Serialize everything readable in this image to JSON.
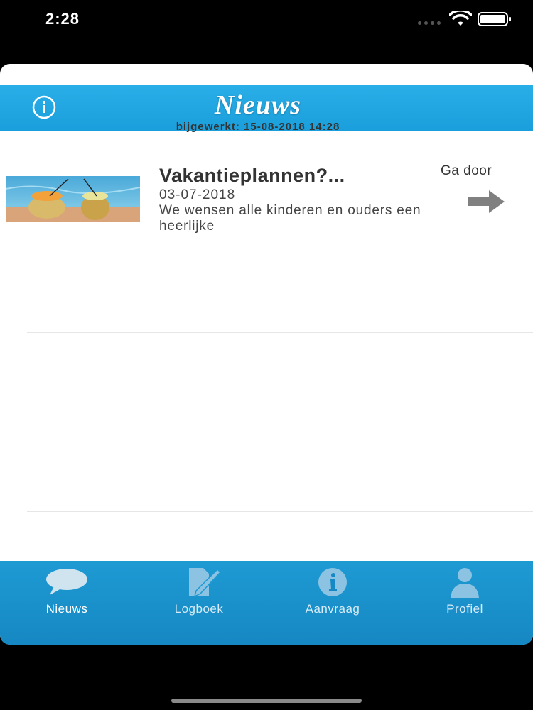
{
  "status_bar": {
    "time": "2:28"
  },
  "header": {
    "title": "Nieuws",
    "updated": "bijgewerkt: 15-08-2018 14:28"
  },
  "news": [
    {
      "title": "Vakantieplannen?...",
      "date": "03-07-2018",
      "excerpt": "We wensen alle kinderen en ouders een heerlijke",
      "go_label": "Ga door",
      "thumbnail": "pineapple-drinks-pool-photo"
    }
  ],
  "tabs": [
    {
      "label": "Nieuws",
      "icon": "speech-bubble-icon",
      "active": true
    },
    {
      "label": "Logboek",
      "icon": "document-pencil-icon",
      "active": false
    },
    {
      "label": "Aanvraag",
      "icon": "info-circle-icon",
      "active": false
    },
    {
      "label": "Profiel",
      "icon": "person-icon",
      "active": false
    }
  ],
  "colors": {
    "nav_blue": "#1a9fdc",
    "tab_blue": "#1688c3",
    "arrow_gray": "#808080"
  }
}
